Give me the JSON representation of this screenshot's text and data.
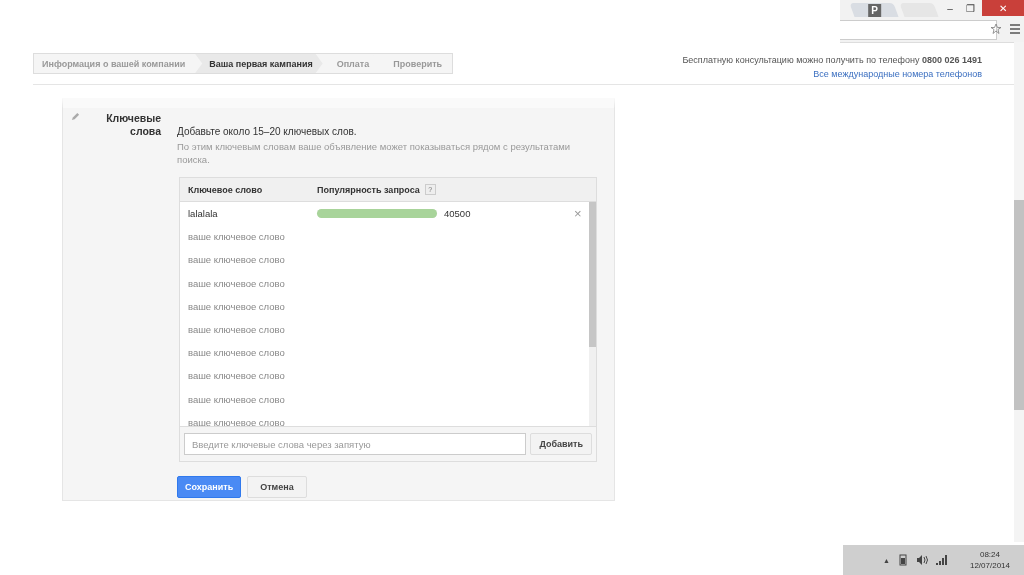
{
  "browser": {
    "tab_label": "P",
    "buttons": [
      "–",
      "❐",
      "✕"
    ]
  },
  "steps": [
    {
      "label": "Информация о вашей компании",
      "selected": false
    },
    {
      "label": "Ваша первая кампания",
      "selected": true
    },
    {
      "label": "Оплата",
      "selected": false
    },
    {
      "label": "Проверить",
      "selected": false
    }
  ],
  "help": {
    "text": "Бесплатную консультацию можно получить по телефону **0800 026 1491**",
    "link": "Все международные номера телефонов"
  },
  "section": {
    "title": "Ключевые слова",
    "intro": "Добавьте около 15–20 ключевых слов.",
    "hint": "По этим ключевым словам ваше объявление может показываться рядом с результатами поиска.",
    "table": {
      "columns": [
        "Ключевое слово",
        "Популярность запроса"
      ],
      "help_mark": "?",
      "rows": [
        {
          "kind": "keyword",
          "keyword": "lalalala",
          "level": 1,
          "volume": "40500",
          "remove": "×"
        },
        {
          "kind": "empty",
          "placeholder": "ваше ключевое слово"
        },
        {
          "kind": "empty",
          "placeholder": "ваше ключевое слово"
        },
        {
          "kind": "empty",
          "placeholder": "ваше ключевое слово"
        },
        {
          "kind": "empty",
          "placeholder": "ваше ключевое слово"
        },
        {
          "kind": "empty",
          "placeholder": "ваше ключевое слово"
        },
        {
          "kind": "empty",
          "placeholder": "ваше ключевое слово"
        },
        {
          "kind": "empty",
          "placeholder": "ваше ключевое слово"
        },
        {
          "kind": "empty",
          "placeholder": "ваше ключевое слово"
        },
        {
          "kind": "empty",
          "placeholder": "ваше ключевое слово"
        }
      ],
      "input": {
        "placeholder": "Введите ключевые слова через запятую"
      },
      "add_button": "Добавить"
    },
    "save": "Сохранить",
    "cancel": "Отмена"
  },
  "taskbar": {
    "up": "▲",
    "time": "08:24",
    "date": "12/07/2014"
  }
}
